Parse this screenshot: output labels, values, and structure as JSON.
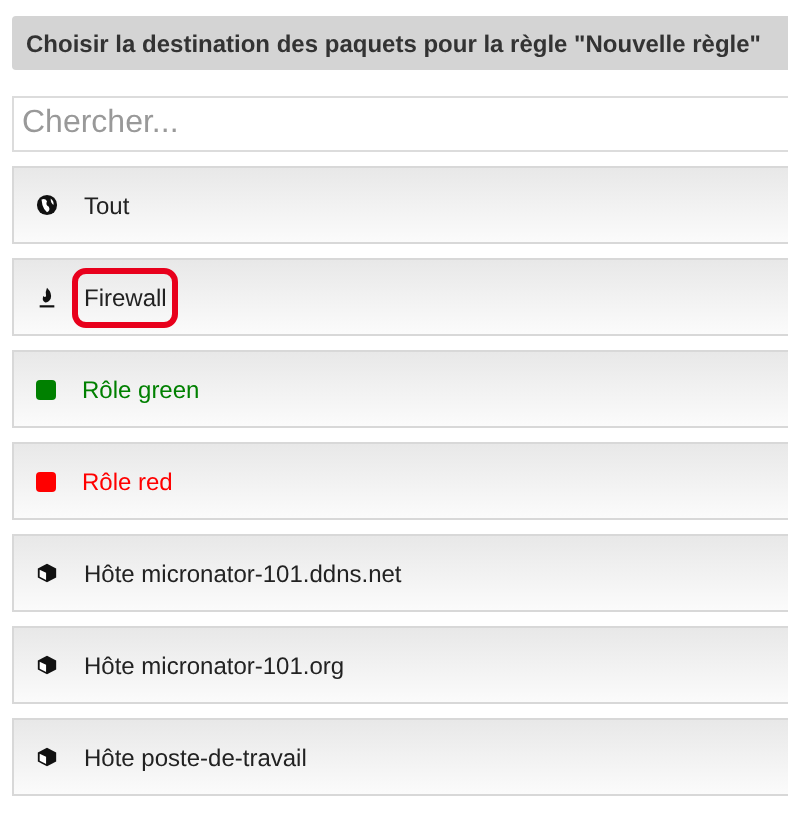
{
  "header": {
    "title": "Choisir la destination des paquets pour la règle \"Nouvelle règle\""
  },
  "search": {
    "placeholder": "Chercher..."
  },
  "items": [
    {
      "kind": "all",
      "label": "Tout",
      "highlighted": false
    },
    {
      "kind": "firewall",
      "label": "Firewall",
      "highlighted": true
    },
    {
      "kind": "role",
      "label": "Rôle green",
      "color": "#008000",
      "highlighted": false
    },
    {
      "kind": "role",
      "label": "Rôle red",
      "color": "#ff0000",
      "highlighted": false
    },
    {
      "kind": "host",
      "label": "Hôte micronator-101.ddns.net",
      "highlighted": false
    },
    {
      "kind": "host",
      "label": "Hôte micronator-101.org",
      "highlighted": false
    },
    {
      "kind": "host",
      "label": "Hôte poste-de-travail",
      "highlighted": false
    }
  ]
}
